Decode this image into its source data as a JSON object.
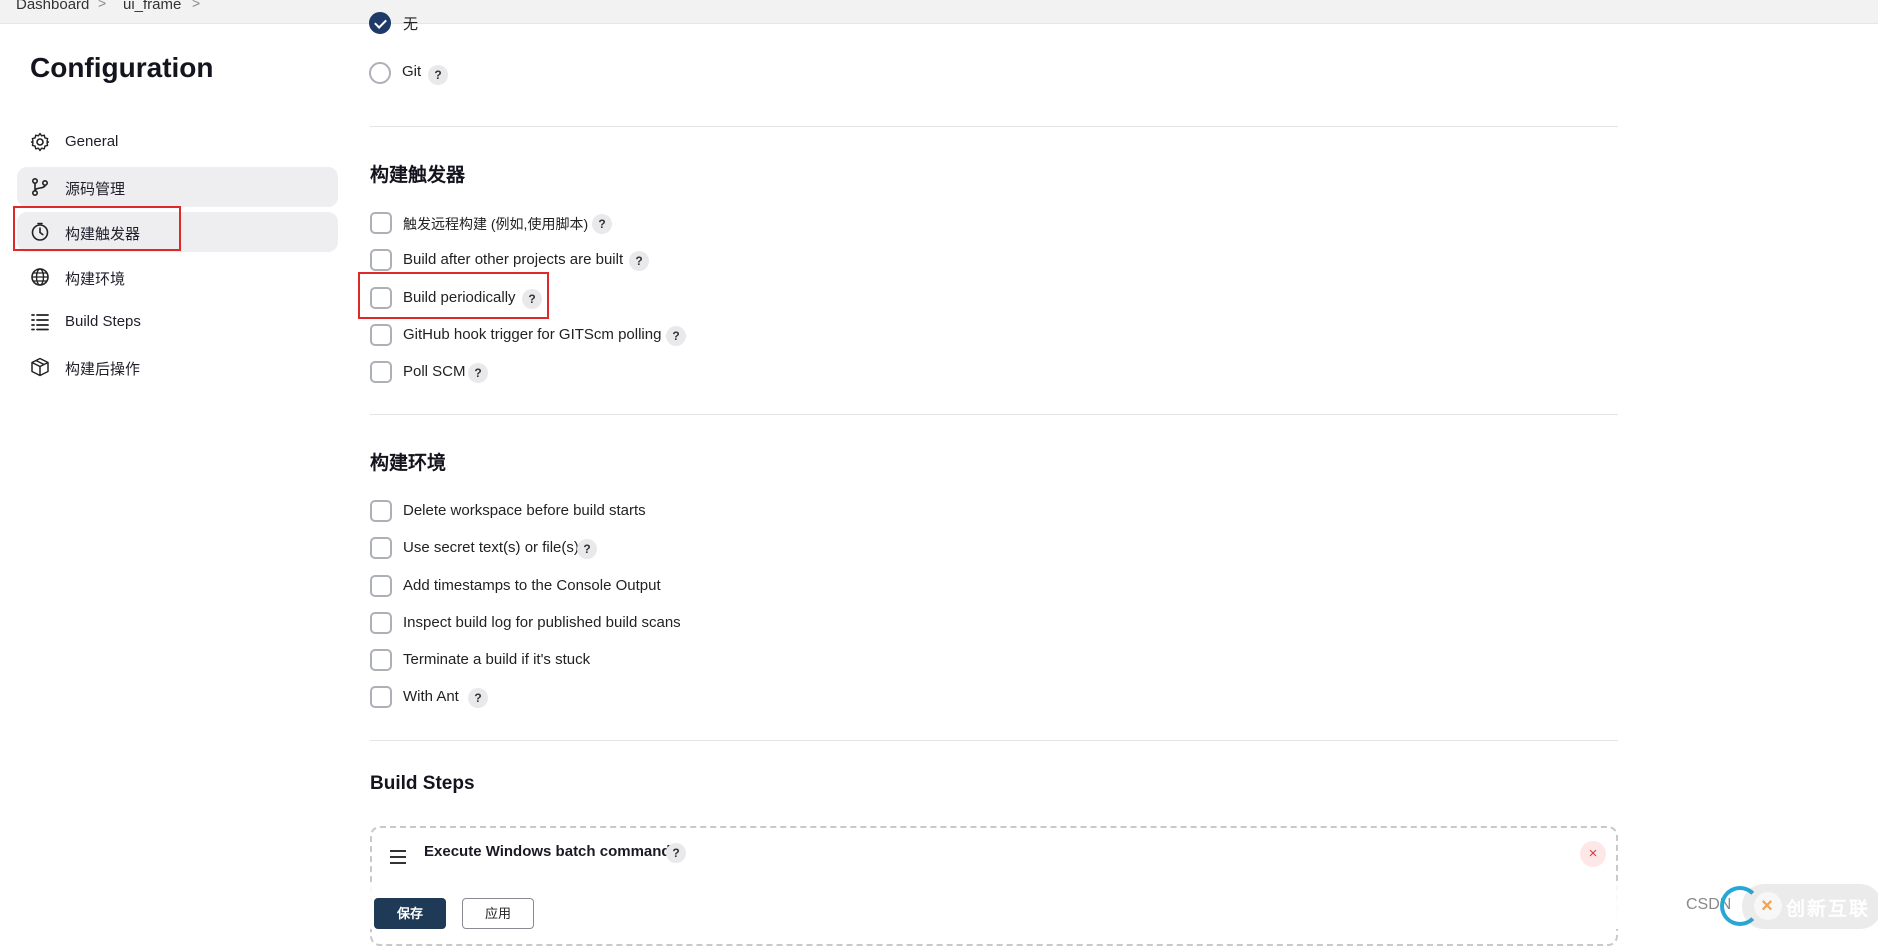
{
  "breadcrumb": {
    "items": [
      "Dashboard",
      "ui_frame"
    ],
    "separator": ">"
  },
  "page": {
    "title": "Configuration"
  },
  "sidebar": {
    "items": [
      {
        "label": "General",
        "icon": "gear-icon"
      },
      {
        "label": "源码管理",
        "icon": "branch-icon"
      },
      {
        "label": "构建触发器",
        "icon": "clock-icon"
      },
      {
        "label": "构建环境",
        "icon": "globe-icon"
      },
      {
        "label": "Build Steps",
        "icon": "list-icon"
      },
      {
        "label": "构建后操作",
        "icon": "cube-icon"
      }
    ],
    "active_index": 2
  },
  "scm": {
    "options": [
      {
        "label": "无",
        "checked": true
      },
      {
        "label": "Git",
        "checked": false,
        "help": "?"
      }
    ]
  },
  "triggers": {
    "title": "构建触发器",
    "options": [
      {
        "label": "触发远程构建 (例如,使用脚本)",
        "help": "?"
      },
      {
        "label": "Build after other projects are built",
        "help": "?"
      },
      {
        "label": "Build periodically",
        "help": "?"
      },
      {
        "label": "GitHub hook trigger for GITScm polling",
        "help": "?"
      },
      {
        "label": "Poll SCM",
        "help": "?"
      }
    ]
  },
  "environment": {
    "title": "构建环境",
    "options": [
      {
        "label": "Delete workspace before build starts"
      },
      {
        "label": "Use secret text(s) or file(s)",
        "help": "?"
      },
      {
        "label": "Add timestamps to the Console Output"
      },
      {
        "label": "Inspect build log for published build scans"
      },
      {
        "label": "Terminate a build if it's stuck"
      },
      {
        "label": "With Ant",
        "help": "?"
      }
    ]
  },
  "build_steps": {
    "title": "Build Steps",
    "step": {
      "title": "Execute Windows batch command",
      "help": "?",
      "close": "×"
    }
  },
  "buttons": {
    "save": "保存",
    "apply": "应用"
  },
  "watermark": {
    "text": "CSDN",
    "brand": "创新互联",
    "brand_mark": "×"
  },
  "colors": {
    "accent": "#1f3a57",
    "highlight": "#e02828",
    "active_bg": "#eeeef1"
  }
}
